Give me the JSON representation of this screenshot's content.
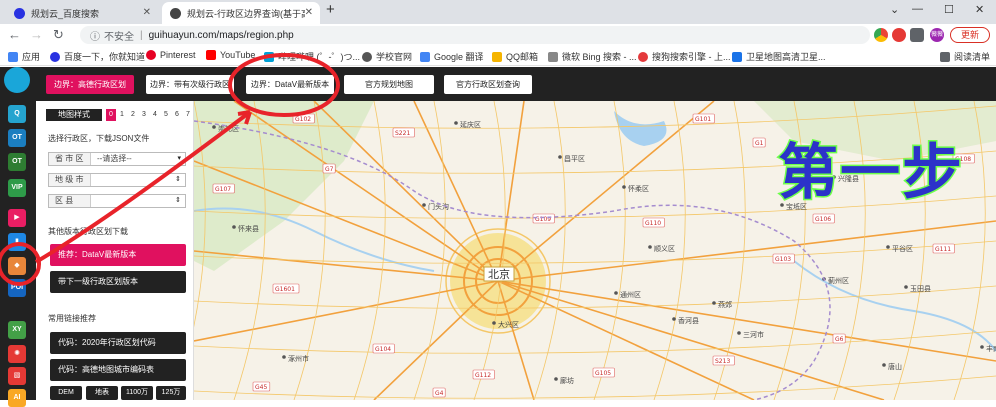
{
  "browser": {
    "tabs": [
      {
        "title": "规划云_百度搜索",
        "active": false
      },
      {
        "title": "规划云-行政区边界查询(基于高",
        "active": true
      }
    ],
    "new_tab": "+",
    "window_controls": [
      "⌄",
      "—",
      "☐",
      "✕"
    ],
    "address": {
      "security_label": "不安全",
      "url": "guihuayun.com/maps/region.php"
    },
    "profile_label": "薇薇",
    "update_label": "更新",
    "bookmarks": [
      {
        "label": "应用",
        "icon": "apps-icon",
        "color": "#4285f4"
      },
      {
        "label": "百度一下，你就知道",
        "icon": "baidu-icon",
        "color": "#2932e1"
      },
      {
        "label": "Pinterest",
        "icon": "pinterest-icon",
        "color": "#e60023"
      },
      {
        "label": "YouTube",
        "icon": "youtube-icon",
        "color": "#ff0000"
      },
      {
        "label": "哔哩哔哩 (゜-゜)つ...",
        "icon": "bilibili-icon",
        "color": "#00a1d6"
      },
      {
        "label": "学校官网",
        "icon": "globe-icon",
        "color": "#555555"
      },
      {
        "label": "Google 翻译",
        "icon": "translate-icon",
        "color": "#4285f4"
      },
      {
        "label": "QQ邮箱",
        "icon": "mail-icon",
        "color": "#f5b400"
      },
      {
        "label": "微软 Bing 搜索 - ...",
        "icon": "bing-icon",
        "color": "#888888"
      },
      {
        "label": "搜狗搜索引擎 - 上...",
        "icon": "sogou-icon",
        "color": "#e4393c"
      },
      {
        "label": "卫星地图高清卫星...",
        "icon": "satellite-icon",
        "color": "#1a73e8"
      }
    ],
    "reading_list": "阅读清单"
  },
  "site": {
    "top_buttons": [
      "边界：高德行政区划",
      "边界：带有次级行政区",
      "边界：DataV最新版本",
      "官方规划地图",
      "官方行政区划查询"
    ],
    "rail_icons": [
      {
        "name": "cloud-logo-icon",
        "text": "",
        "color": "#1aa6d9"
      },
      {
        "name": "search-map-icon",
        "text": "Q",
        "color": "#25a4cf"
      },
      {
        "name": "osm-icon",
        "text": "OT",
        "color": "#1b7ec0"
      },
      {
        "name": "geo-icon",
        "text": "OT",
        "color": "#2e7d32"
      },
      {
        "name": "vip-icon",
        "text": "VIP",
        "color": "#2e9b49"
      },
      {
        "name": "video-icon",
        "text": "▶",
        "color": "#e91e63"
      },
      {
        "name": "book-icon",
        "text": "▮",
        "color": "#1e88e5"
      },
      {
        "name": "region-icon",
        "text": "◆",
        "color": "#e8863a"
      },
      {
        "name": "poi-icon",
        "text": "POI",
        "color": "#1565c0"
      },
      {
        "name": "xy-icon",
        "text": "XY",
        "color": "#43a047"
      },
      {
        "name": "bulb-icon",
        "text": "✺",
        "color": "#e53935"
      },
      {
        "name": "image-icon",
        "text": "▧",
        "color": "#e53935"
      },
      {
        "name": "ai-icon",
        "text": "AI",
        "color": "#f9a825"
      }
    ],
    "panel": {
      "style_label": "地图样式",
      "style_numbers": [
        "0",
        "1",
        "2",
        "3",
        "4",
        "5",
        "6",
        "7",
        "8"
      ],
      "download_heading": "选择行政区，下载JSON文件",
      "province_label": "省 市 区",
      "province_value": "--请选择--",
      "city_label": "地 级 市",
      "district_label": "区      县",
      "other_heading": "其他版本行政区划下载",
      "recommend_btn": "推荐：DataV最新版本",
      "lower_level_btn": "带下一级行政区划版本",
      "links_heading": "常用链接推荐",
      "link_2020": "代码：2020年行政区划代码",
      "link_gaode": "代码：高德地图城市编码表",
      "small_buttons": [
        "DEM",
        "地表",
        "1100万",
        "125万"
      ]
    }
  },
  "map": {
    "capital_label": "北京",
    "places": [
      "平谷区",
      "廊坊",
      "唐山",
      "怀柔区",
      "延庆区",
      "昌平区",
      "门头沟",
      "大兴区",
      "通州区",
      "怀来县",
      "涿州市",
      "三河市",
      "丰南区",
      "兴隆县",
      "玉田县",
      "香河县",
      "顺义区",
      "燕郊",
      "崇礼区",
      "蓟州区",
      "宝坻区"
    ],
    "roads": [
      "G1",
      "G4",
      "G6",
      "G7",
      "G45",
      "G101",
      "G102",
      "G103",
      "G104",
      "G105",
      "G106",
      "G107",
      "G108",
      "G109",
      "G110",
      "G111",
      "G112",
      "G1601",
      "S213",
      "S221"
    ],
    "colors": {
      "land": "#f6f2e8",
      "highway": "#f2a13d",
      "road": "#f4c768",
      "city": "#f6dd75",
      "water": "#a8d1f0",
      "park": "#cfe6b8"
    }
  },
  "overlay": {
    "step_text": "第一步",
    "annotation_color": "#e8232a"
  }
}
